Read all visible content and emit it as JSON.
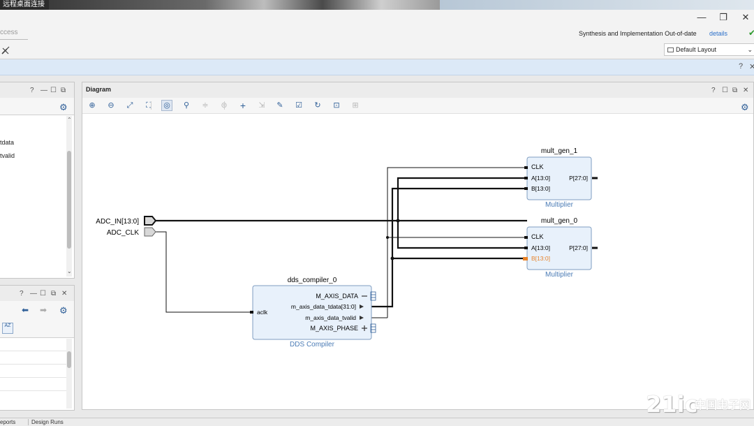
{
  "window": {
    "title": "远程桌面连接",
    "min_glyph": "—",
    "restore_glyph": "❐",
    "close_glyph": "✕"
  },
  "header": {
    "quick_access": "ccess",
    "status_text": "Synthesis and Implementation Out-of-date",
    "status_link": "details",
    "status_check": "✔",
    "layout_select": "Default Layout",
    "chevron": "⌄",
    "info_help": "?",
    "info_close": "✕"
  },
  "left_panel_top": {
    "items": [
      "tdata",
      "tvalid"
    ],
    "controls": [
      "?",
      "—",
      "☐",
      "⧉"
    ],
    "gear": "⚙"
  },
  "left_panel_bottom": {
    "controls": [
      "?",
      "—",
      "☐",
      "✕"
    ],
    "nav_back": "⬅",
    "nav_fwd": "➡",
    "gear": "⚙",
    "sort_icon": "AZ"
  },
  "diagram": {
    "title": "Diagram",
    "controls": [
      "?",
      "☐",
      "⧉",
      "✕"
    ],
    "gear": "⚙",
    "toolbar_icons": [
      "zoom-in",
      "zoom-out",
      "zoom-fit",
      "fit-selection",
      "auto-fit",
      "search",
      "collapse",
      "expand",
      "add",
      "connect",
      "wrench",
      "validate",
      "regenerate",
      "optimize",
      "debug"
    ],
    "ports": {
      "adc_in": "ADC_IN[13:0]",
      "adc_clk": "ADC_CLK"
    },
    "blocks": {
      "mult1": {
        "name": "mult_gen_1",
        "type": "Multiplier",
        "clk": "CLK",
        "a": "A[13:0]",
        "b": "B[13:0]",
        "p": "P[27:0]"
      },
      "mult0": {
        "name": "mult_gen_0",
        "type": "Multiplier",
        "clk": "CLK",
        "a": "A[13:0]",
        "b": "B[13:0]",
        "p": "P[27:0]"
      },
      "dds": {
        "name": "dds_compiler_0",
        "type": "DDS Compiler",
        "aclk": "aclk",
        "m_axis_data": "M_AXIS_DATA",
        "tdata": "m_axis_data_tdata[31:0]",
        "tvalid": "m_axis_data_tvalid",
        "m_axis_phase": "M_AXIS_PHASE"
      }
    }
  },
  "bottom": {
    "tab1": "eports",
    "tab2": "Design Runs"
  },
  "watermark": {
    "main": "21ic",
    "sub": "中国电子网"
  },
  "colors": {
    "block_fill": "#e8f1fb",
    "block_stroke": "#7f9dc0",
    "wire": "#111111",
    "highlight_pin": "#e8832a",
    "info_bar": "#dce9f7"
  }
}
